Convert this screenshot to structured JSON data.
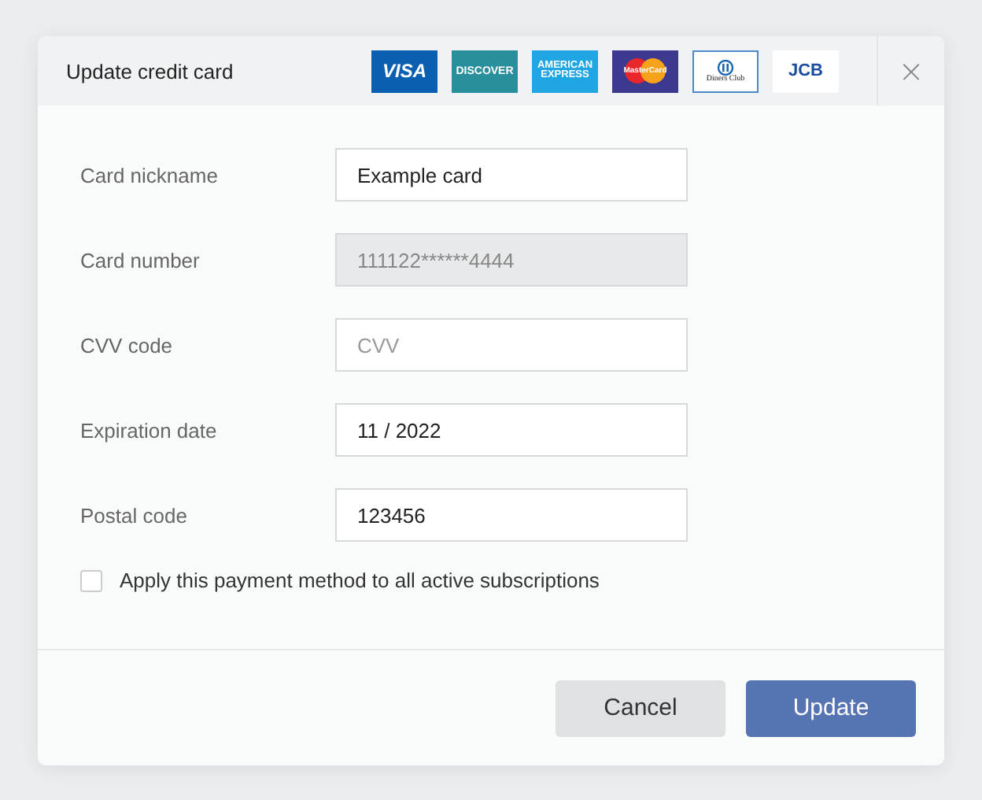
{
  "dialog": {
    "title": "Update credit card",
    "card_logos": [
      {
        "kind": "visa",
        "lines": [
          "VISA"
        ]
      },
      {
        "kind": "discover",
        "lines": [
          "DISCOVER"
        ]
      },
      {
        "kind": "amex",
        "lines": [
          "AMERICAN",
          "EXPRESS"
        ]
      },
      {
        "kind": "mastercard",
        "lines": [
          "MasterCard"
        ]
      },
      {
        "kind": "diners",
        "lines": [
          "Diners Club"
        ]
      },
      {
        "kind": "jcb",
        "lines": [
          "JCB"
        ]
      }
    ],
    "close": "×",
    "fields": [
      {
        "label": "Card nickname",
        "value": "Example card",
        "disabled": false
      },
      {
        "label": "Card number",
        "value": "111122******4444",
        "disabled": true
      },
      {
        "label": "CVV code",
        "placeholder": "CVV",
        "disabled": false
      },
      {
        "label": "Expiration date",
        "value": "11 / 2022",
        "disabled": false
      },
      {
        "label": "Postal code",
        "value": "123456",
        "disabled": false
      }
    ],
    "checkbox": {
      "label": "Apply this payment method to all active subscriptions",
      "checked": false
    },
    "buttons": [
      {
        "label": "Cancel",
        "kind": "secondary"
      },
      {
        "label": "Update",
        "kind": "primary"
      }
    ]
  }
}
